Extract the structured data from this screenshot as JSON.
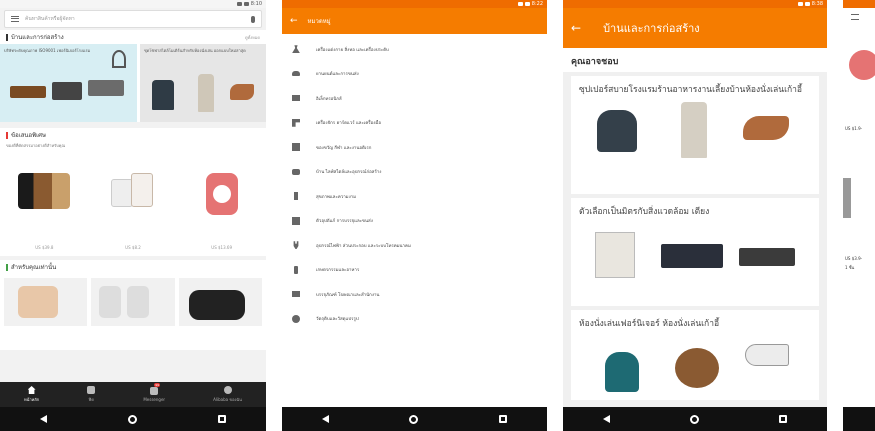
{
  "screens": [
    {
      "id": "home",
      "status_time": "8:10",
      "search_placeholder": "ค้นหาสินค้าหรือผู้จัดหา",
      "section1": {
        "title": "บ้านและการก่อสร้าง",
        "link": "ดูทั้งหมด"
      },
      "banner_a_text": "บริษัทระดับคุณภาพ ISO9001 เฟอร์นิเจอร์โรงแรม",
      "banner_b_text": "ชุดโซฟาสไตล์โมเดิร์นสำหรับห้องนั่งเล่น ออกแบบใหม่ล่าสุด",
      "flash": {
        "title": "ข้อเสนอพิเศษ",
        "subtitle": "ของดีที่คัดสรรมาอย่างดีสำหรับคุณ",
        "prices": [
          "US $39.8",
          "US $8.2",
          "US $13.69"
        ]
      },
      "foryou": {
        "title": "สำหรับคุณเท่านั้น"
      },
      "tabs": [
        {
          "label": "หน้าหลัก",
          "active": true
        },
        {
          "label": "ฟีด"
        },
        {
          "label": "Messenger",
          "badge": "99"
        },
        {
          "label": "Alibaba ของฉัน"
        }
      ]
    },
    {
      "id": "categories",
      "status_time": "8:22",
      "header": "หมวดหมู่",
      "items": [
        {
          "label": "เครื่องแต่งกาย สิ่งทอ และเครื่องประดับ",
          "icon": "dress-icon"
        },
        {
          "label": "ยานยนต์และการขนส่ง",
          "icon": "car-icon"
        },
        {
          "label": "อิเล็กทรอนิกส์",
          "icon": "monitor-icon"
        },
        {
          "label": "เครื่องจักร ฮาร์ดแวร์ และเครื่องมือ",
          "icon": "drill-icon"
        },
        {
          "label": "ของขวัญ กีฬา และงานอดิเรก",
          "icon": "gift-icon"
        },
        {
          "label": "บ้าน ไลฟ์สไตล์และอุปกรณ์ก่อสร้าง",
          "icon": "sofa-icon"
        },
        {
          "label": "สุขภาพและความงาม",
          "icon": "bottle-icon"
        },
        {
          "label": "ตัวอุปถัมภ์ การบรรจุและขนส่ง",
          "icon": "box-icon"
        },
        {
          "label": "อุปกรณ์ไฟฟ้า ส่วนประกอบ และระบบโทรคมนาคม",
          "icon": "plug-icon"
        },
        {
          "label": "เกษตรกรรมและอาหาร",
          "icon": "bottle2-icon"
        },
        {
          "label": "บรรจุภัณฑ์ โฆษณาและสำนักงาน",
          "icon": "print-icon"
        },
        {
          "label": "วัตถุดิบและวัสดุแปรรูป",
          "icon": "drop-icon"
        }
      ]
    },
    {
      "id": "home-construction",
      "status_time": "8:38",
      "header": "บ้านและการก่อสร้าง",
      "subtitle": "คุณอาจชอบ",
      "cards": [
        {
          "title": "ซุปเปอร์สบายโรงแรมร้านอาหารงานเลี้ยงบ้านห้องนั่งเล่นเก้าอี้"
        },
        {
          "title": "ตัวเลือกเป็นมิตรกับสิ่งแวดล้อม เตียง"
        },
        {
          "title": "ห้องนั่งเล่นเฟอร์นิเจอร์ ห้องนั่งเล่นเก้าอี้"
        }
      ]
    },
    {
      "id": "partial",
      "texts": [
        "US $1.9-",
        "US $3.9-",
        "1 ชิ้น"
      ]
    }
  ],
  "colors": {
    "brand_orange": "#f57c00",
    "status_orange": "#ef6c00"
  }
}
